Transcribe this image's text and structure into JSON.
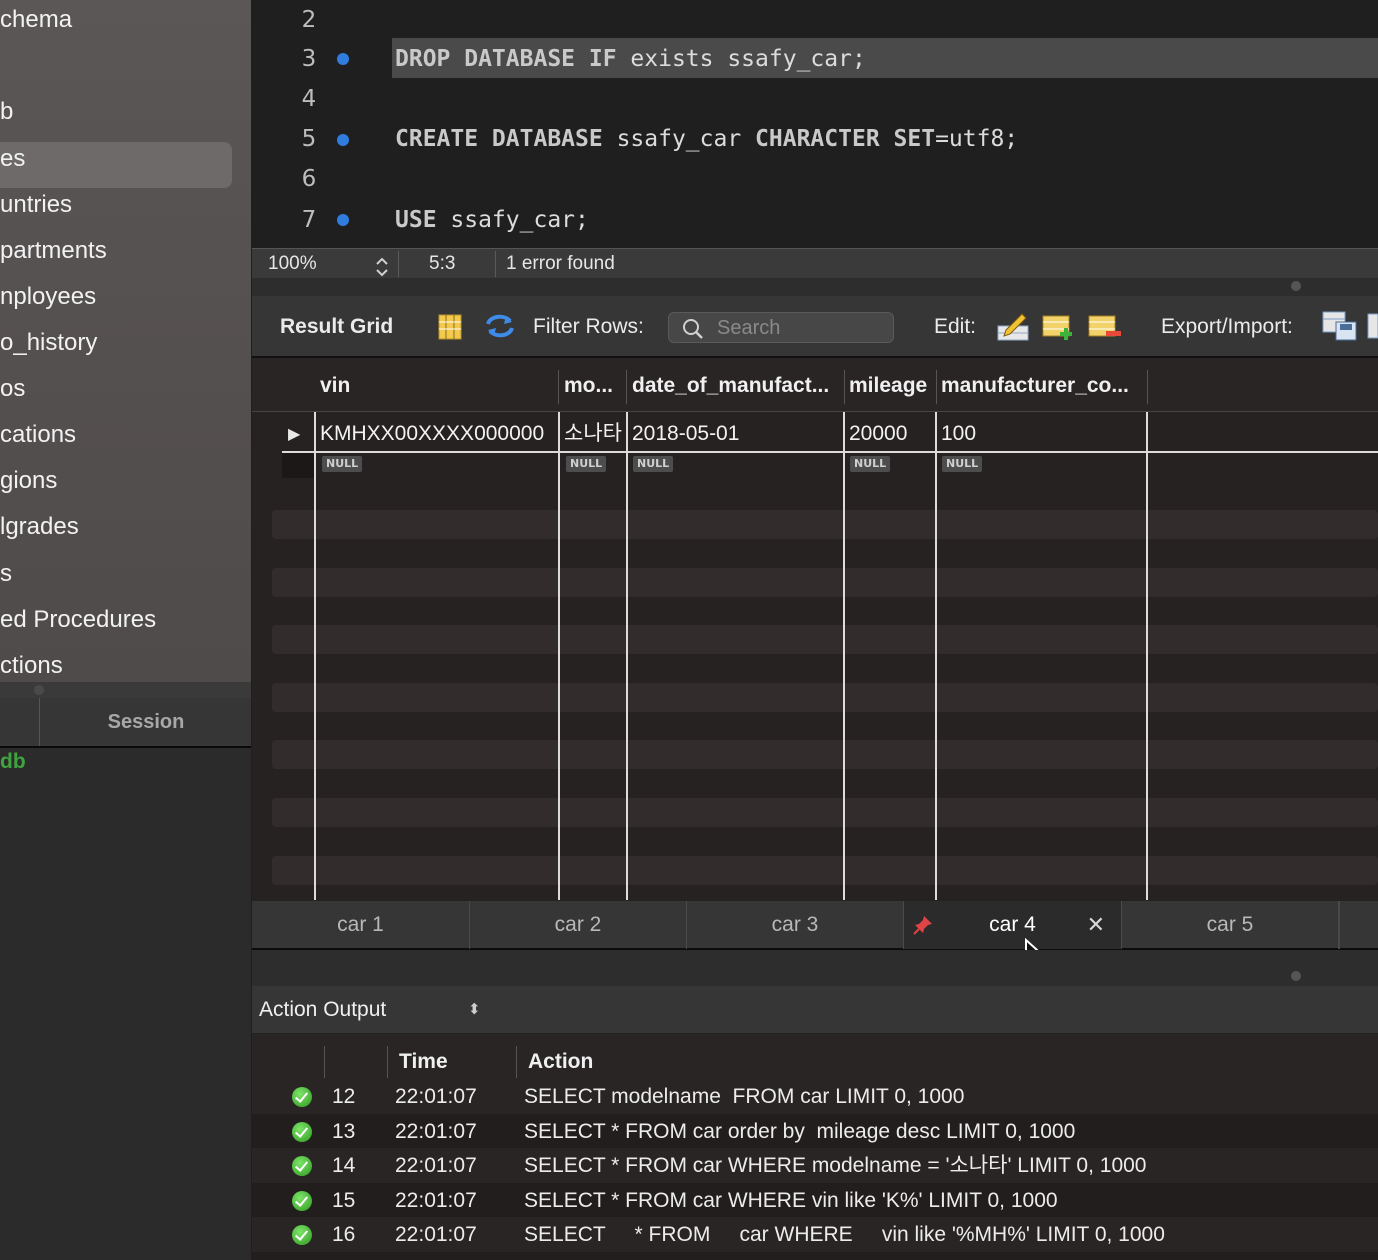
{
  "sidebar": {
    "items": [
      {
        "label": "chema"
      },
      {
        "label": "b"
      },
      {
        "label": "es"
      },
      {
        "label": "untries"
      },
      {
        "label": "partments"
      },
      {
        "label": "nployees"
      },
      {
        "label": "o_history"
      },
      {
        "label": "os"
      },
      {
        "label": "cations"
      },
      {
        "label": "gions"
      },
      {
        "label": "lgrades"
      },
      {
        "label": "s"
      },
      {
        "label": "ed Procedures"
      },
      {
        "label": "ctions"
      }
    ],
    "session_tab": "Session",
    "db_label": "db"
  },
  "editor": {
    "lines": [
      {
        "num": "2"
      },
      {
        "num": "3",
        "keywords": "DROP DATABASE IF",
        "rest": " exists ssafy_car;"
      },
      {
        "num": "4"
      },
      {
        "num": "5",
        "keywords": "CREATE DATABASE",
        "rest": " ssafy_car ",
        "keywords2": "CHARACTER SET",
        "rest2": "=utf8;"
      },
      {
        "num": "6"
      },
      {
        "num": "7",
        "keywords": "USE",
        "rest": " ssafy_car;"
      }
    ],
    "status": {
      "zoom": "100%",
      "cursor": "5:3",
      "errors": "1 error found"
    }
  },
  "result_toolbar": {
    "title": "Result Grid",
    "filter_label": "Filter Rows:",
    "search_placeholder": "Search",
    "edit_label": "Edit:",
    "export_label": "Export/Import:"
  },
  "grid": {
    "columns": [
      "vin",
      "mo...",
      "date_of_manufact...",
      "mileage",
      "manufacturer_co..."
    ],
    "row": {
      "vin": "KMHXX00XXXX000000",
      "model": "소나타",
      "date": "2018-05-01",
      "mileage": "20000",
      "manufacturer": "100"
    },
    "null_label": "NULL"
  },
  "result_tabs": [
    "car 1",
    "car 2",
    "car 3",
    "car 4",
    "car 5"
  ],
  "active_tab": "car 4",
  "output": {
    "title": "Action Output",
    "columns": {
      "time": "Time",
      "action": "Action"
    },
    "rows": [
      {
        "num": "12",
        "time": "22:01:07",
        "action": "SELECT modelname  FROM car LIMIT 0, 1000"
      },
      {
        "num": "13",
        "time": "22:01:07",
        "action": "SELECT * FROM car order by  mileage desc LIMIT 0, 1000"
      },
      {
        "num": "14",
        "time": "22:01:07",
        "action": "SELECT * FROM car WHERE modelname = '소나타' LIMIT 0, 1000"
      },
      {
        "num": "15",
        "time": "22:01:07",
        "action": "SELECT * FROM car WHERE vin like 'K%' LIMIT 0, 1000"
      },
      {
        "num": "16",
        "time": "22:01:07",
        "action": "SELECT     * FROM     car WHERE     vin like '%MH%' LIMIT 0, 1000"
      }
    ]
  },
  "colors": {
    "breakpoint": "#2f7dde",
    "success": "#3cb52a",
    "db_green": "#3fa43f",
    "pin": "#e04343"
  }
}
